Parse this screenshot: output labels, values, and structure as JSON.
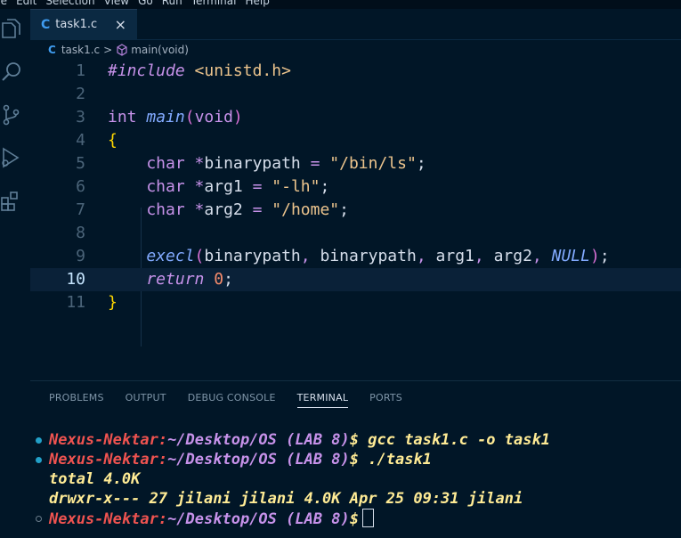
{
  "menu": [
    "ile",
    "Edit",
    "Selection",
    "View",
    "Go",
    "Run",
    "Terminal",
    "Help"
  ],
  "tab": {
    "icon": "C",
    "label": "task1.c",
    "close": "×"
  },
  "breadcrumb": {
    "icon": "C",
    "file": "task1.c",
    "separator": ">",
    "symbol": "main(void)"
  },
  "editor": {
    "active_line": 10,
    "lines": [
      {
        "n": "1",
        "tokens": [
          {
            "t": "#include",
            "c": "t-pre"
          },
          {
            "t": " ",
            "c": ""
          },
          {
            "t": "<unistd.h>",
            "c": "t-str"
          }
        ]
      },
      {
        "n": "2",
        "tokens": []
      },
      {
        "n": "3",
        "tokens": [
          {
            "t": "int",
            "c": "t-type"
          },
          {
            "t": " ",
            "c": ""
          },
          {
            "t": "main",
            "c": "t-fn"
          },
          {
            "t": "(",
            "c": "t-paren"
          },
          {
            "t": "void",
            "c": "t-type"
          },
          {
            "t": ")",
            "c": "t-paren"
          }
        ]
      },
      {
        "n": "4",
        "tokens": [
          {
            "t": "{",
            "c": "t-brace"
          }
        ]
      },
      {
        "n": "5",
        "tokens": [
          {
            "t": "    char",
            "c": "t-type"
          },
          {
            "t": " ",
            "c": ""
          },
          {
            "t": "*",
            "c": "t-op"
          },
          {
            "t": "binarypath",
            "c": "t-var"
          },
          {
            "t": " = ",
            "c": "t-op"
          },
          {
            "t": "\"/bin/ls\"",
            "c": "t-str"
          },
          {
            "t": ";",
            "c": "t-var"
          }
        ]
      },
      {
        "n": "6",
        "tokens": [
          {
            "t": "    char",
            "c": "t-type"
          },
          {
            "t": " ",
            "c": ""
          },
          {
            "t": "*",
            "c": "t-op"
          },
          {
            "t": "arg1",
            "c": "t-var"
          },
          {
            "t": " = ",
            "c": "t-op"
          },
          {
            "t": "\"-lh\"",
            "c": "t-str"
          },
          {
            "t": ";",
            "c": "t-var"
          }
        ]
      },
      {
        "n": "7",
        "tokens": [
          {
            "t": "    char",
            "c": "t-type"
          },
          {
            "t": " ",
            "c": ""
          },
          {
            "t": "*",
            "c": "t-op"
          },
          {
            "t": "arg2",
            "c": "t-var"
          },
          {
            "t": " = ",
            "c": "t-op"
          },
          {
            "t": "\"/home\"",
            "c": "t-str"
          },
          {
            "t": ";",
            "c": "t-var"
          }
        ]
      },
      {
        "n": "8",
        "tokens": []
      },
      {
        "n": "9",
        "tokens": [
          {
            "t": "    execl",
            "c": "t-fn"
          },
          {
            "t": "(",
            "c": "t-paren"
          },
          {
            "t": "binarypath",
            "c": "t-var"
          },
          {
            "t": ", ",
            "c": "t-punc"
          },
          {
            "t": "binarypath",
            "c": "t-var"
          },
          {
            "t": ", ",
            "c": "t-punc"
          },
          {
            "t": "arg1",
            "c": "t-var"
          },
          {
            "t": ", ",
            "c": "t-punc"
          },
          {
            "t": "arg2",
            "c": "t-var"
          },
          {
            "t": ", ",
            "c": "t-punc"
          },
          {
            "t": "NULL",
            "c": "t-null"
          },
          {
            "t": ")",
            "c": "t-paren"
          },
          {
            "t": ";",
            "c": "t-var"
          }
        ]
      },
      {
        "n": "10",
        "tokens": [
          {
            "t": "    return",
            "c": "t-kw"
          },
          {
            "t": " ",
            "c": ""
          },
          {
            "t": "0",
            "c": "t-num"
          },
          {
            "t": ";",
            "c": "t-var"
          }
        ]
      },
      {
        "n": "11",
        "tokens": [
          {
            "t": "}",
            "c": "t-brace"
          }
        ]
      }
    ]
  },
  "panel": {
    "tabs": [
      "PROBLEMS",
      "OUTPUT",
      "DEBUG CONSOLE",
      "TERMINAL",
      "PORTS"
    ],
    "active_tab": "TERMINAL"
  },
  "terminal": {
    "host": "Nexus-Nektar:",
    "path": "~/Desktop/OS (LAB 8)",
    "symbol": "$",
    "lines": [
      {
        "type": "prompt",
        "cmd": " gcc task1.c -o task1"
      },
      {
        "type": "prompt",
        "cmd": " ./task1"
      },
      {
        "type": "output",
        "text": "total 4.0K"
      },
      {
        "type": "output",
        "text": "drwxr-x--- 27 jilani jilani 4.0K Apr 25 09:31 jilani"
      },
      {
        "type": "prompt-current",
        "cmd": ""
      }
    ]
  },
  "colors": {
    "background": "#011627",
    "host": "#ef5350",
    "path": "#c792ea",
    "command": "#ffeb95"
  }
}
